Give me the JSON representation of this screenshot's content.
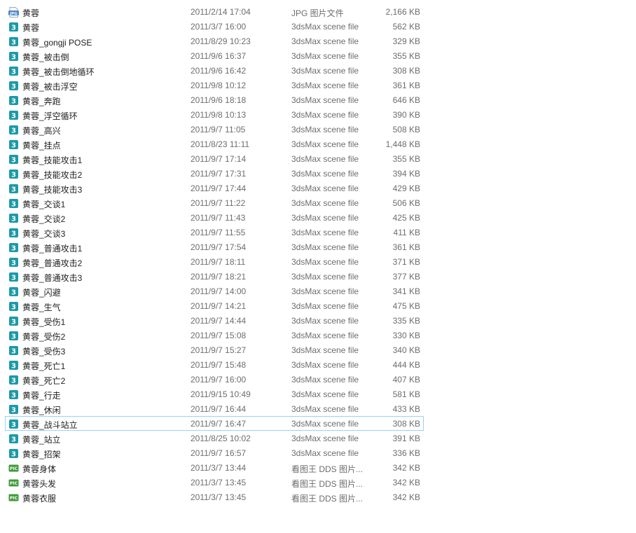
{
  "files": [
    {
      "icon": "jpg-file-icon",
      "name": "黄蓉",
      "date": "2011/2/14 17:04",
      "type": "JPG 图片文件",
      "size": "2,166 KB"
    },
    {
      "icon": "3dsmax-file-icon",
      "name": "黄蓉",
      "date": "2011/3/7 16:00",
      "type": "3dsMax scene file",
      "size": "562 KB"
    },
    {
      "icon": "3dsmax-file-icon",
      "name": "黄蓉_gongji POSE",
      "date": "2011/8/29 10:23",
      "type": "3dsMax scene file",
      "size": "329 KB"
    },
    {
      "icon": "3dsmax-file-icon",
      "name": "黄蓉_被击倒",
      "date": "2011/9/6 16:37",
      "type": "3dsMax scene file",
      "size": "355 KB"
    },
    {
      "icon": "3dsmax-file-icon",
      "name": "黄蓉_被击倒地循环",
      "date": "2011/9/6 16:42",
      "type": "3dsMax scene file",
      "size": "308 KB"
    },
    {
      "icon": "3dsmax-file-icon",
      "name": "黄蓉_被击浮空",
      "date": "2011/9/8 10:12",
      "type": "3dsMax scene file",
      "size": "361 KB"
    },
    {
      "icon": "3dsmax-file-icon",
      "name": "黄蓉_奔跑",
      "date": "2011/9/6 18:18",
      "type": "3dsMax scene file",
      "size": "646 KB"
    },
    {
      "icon": "3dsmax-file-icon",
      "name": "黄蓉_浮空循环",
      "date": "2011/9/8 10:13",
      "type": "3dsMax scene file",
      "size": "390 KB"
    },
    {
      "icon": "3dsmax-file-icon",
      "name": "黄蓉_高兴",
      "date": "2011/9/7 11:05",
      "type": "3dsMax scene file",
      "size": "508 KB"
    },
    {
      "icon": "3dsmax-file-icon",
      "name": "黄蓉_挂点",
      "date": "2011/8/23 11:11",
      "type": "3dsMax scene file",
      "size": "1,448 KB"
    },
    {
      "icon": "3dsmax-file-icon",
      "name": "黄蓉_技能攻击1",
      "date": "2011/9/7 17:14",
      "type": "3dsMax scene file",
      "size": "355 KB"
    },
    {
      "icon": "3dsmax-file-icon",
      "name": "黄蓉_技能攻击2",
      "date": "2011/9/7 17:31",
      "type": "3dsMax scene file",
      "size": "394 KB"
    },
    {
      "icon": "3dsmax-file-icon",
      "name": "黄蓉_技能攻击3",
      "date": "2011/9/7 17:44",
      "type": "3dsMax scene file",
      "size": "429 KB"
    },
    {
      "icon": "3dsmax-file-icon",
      "name": "黄蓉_交谈1",
      "date": "2011/9/7 11:22",
      "type": "3dsMax scene file",
      "size": "506 KB"
    },
    {
      "icon": "3dsmax-file-icon",
      "name": "黄蓉_交谈2",
      "date": "2011/9/7 11:43",
      "type": "3dsMax scene file",
      "size": "425 KB"
    },
    {
      "icon": "3dsmax-file-icon",
      "name": "黄蓉_交谈3",
      "date": "2011/9/7 11:55",
      "type": "3dsMax scene file",
      "size": "411 KB"
    },
    {
      "icon": "3dsmax-file-icon",
      "name": "黄蓉_普通攻击1",
      "date": "2011/9/7 17:54",
      "type": "3dsMax scene file",
      "size": "361 KB"
    },
    {
      "icon": "3dsmax-file-icon",
      "name": "黄蓉_普通攻击2",
      "date": "2011/9/7 18:11",
      "type": "3dsMax scene file",
      "size": "371 KB"
    },
    {
      "icon": "3dsmax-file-icon",
      "name": "黄蓉_普通攻击3",
      "date": "2011/9/7 18:21",
      "type": "3dsMax scene file",
      "size": "377 KB"
    },
    {
      "icon": "3dsmax-file-icon",
      "name": "黄蓉_闪避",
      "date": "2011/9/7 14:00",
      "type": "3dsMax scene file",
      "size": "341 KB"
    },
    {
      "icon": "3dsmax-file-icon",
      "name": "黄蓉_生气",
      "date": "2011/9/7 14:21",
      "type": "3dsMax scene file",
      "size": "475 KB"
    },
    {
      "icon": "3dsmax-file-icon",
      "name": "黄蓉_受伤1",
      "date": "2011/9/7 14:44",
      "type": "3dsMax scene file",
      "size": "335 KB"
    },
    {
      "icon": "3dsmax-file-icon",
      "name": "黄蓉_受伤2",
      "date": "2011/9/7 15:08",
      "type": "3dsMax scene file",
      "size": "330 KB"
    },
    {
      "icon": "3dsmax-file-icon",
      "name": "黄蓉_受伤3",
      "date": "2011/9/7 15:27",
      "type": "3dsMax scene file",
      "size": "340 KB"
    },
    {
      "icon": "3dsmax-file-icon",
      "name": "黄蓉_死亡1",
      "date": "2011/9/7 15:48",
      "type": "3dsMax scene file",
      "size": "444 KB"
    },
    {
      "icon": "3dsmax-file-icon",
      "name": "黄蓉_死亡2",
      "date": "2011/9/7 16:00",
      "type": "3dsMax scene file",
      "size": "407 KB"
    },
    {
      "icon": "3dsmax-file-icon",
      "name": "黄蓉_行走",
      "date": "2011/9/15 10:49",
      "type": "3dsMax scene file",
      "size": "581 KB"
    },
    {
      "icon": "3dsmax-file-icon",
      "name": "黄蓉_休闲",
      "date": "2011/9/7 16:44",
      "type": "3dsMax scene file",
      "size": "433 KB"
    },
    {
      "icon": "3dsmax-file-icon",
      "name": "黄蓉_战斗站立",
      "date": "2011/9/7 16:47",
      "type": "3dsMax scene file",
      "size": "308 KB",
      "selected": true
    },
    {
      "icon": "3dsmax-file-icon",
      "name": "黄蓉_站立",
      "date": "2011/8/25 10:02",
      "type": "3dsMax scene file",
      "size": "391 KB"
    },
    {
      "icon": "3dsmax-file-icon",
      "name": "黄蓉_招架",
      "date": "2011/9/7 16:57",
      "type": "3dsMax scene file",
      "size": "336 KB"
    },
    {
      "icon": "dds-file-icon",
      "name": "黄蓉身体",
      "date": "2011/3/7 13:44",
      "type": "看图王 DDS 图片...",
      "size": "342 KB"
    },
    {
      "icon": "dds-file-icon",
      "name": "黄蓉头发",
      "date": "2011/3/7 13:45",
      "type": "看图王 DDS 图片...",
      "size": "342 KB"
    },
    {
      "icon": "dds-file-icon",
      "name": "黄蓉衣服",
      "date": "2011/3/7 13:45",
      "type": "看图王 DDS 图片...",
      "size": "342 KB"
    }
  ],
  "icon_labels": {
    "jpg": "JPG",
    "max": "3",
    "dds": "PIC"
  },
  "colors": {
    "selection_border": "#99d1ff",
    "max_icon": "#1b9aaa",
    "jpg_icon": "#4a86c8",
    "dds_icon": "#3f9b3a"
  }
}
